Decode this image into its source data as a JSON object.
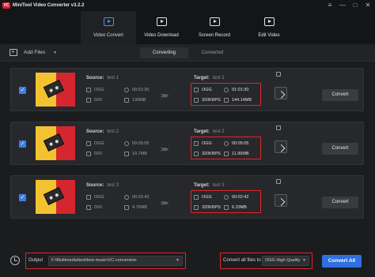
{
  "app": {
    "title": "MiniTool Video Converter v3.2.2",
    "logo_text": "VC"
  },
  "window_controls": [
    "≡",
    "—",
    "□",
    "✕"
  ],
  "nav": [
    {
      "label": "Video Convert",
      "icon": "video-convert-icon",
      "active": true
    },
    {
      "label": "Video Download",
      "icon": "video-download-icon",
      "active": false
    },
    {
      "label": "Screen Record",
      "icon": "screen-record-icon",
      "active": false
    },
    {
      "label": "Edit Video",
      "icon": "edit-video-icon",
      "active": false
    }
  ],
  "toolbar": {
    "add_files_label": "Add Files",
    "add_files_caret": "▼",
    "tabs": [
      "Converting",
      "Converted"
    ],
    "active_tab": "Converting"
  },
  "source_label": "Source:",
  "target_label": "Target:",
  "convert_label": "Convert",
  "arrows": ">>>",
  "files": [
    {
      "source_name": "test 1",
      "target_name": "test 1",
      "src_format": "OGG",
      "src_duration": "00:01:30",
      "src_res": "0X0",
      "src_size": "130MB",
      "tgt_format": "OGG",
      "tgt_duration": "01:01:30",
      "tgt_bitrate": "320KBPS",
      "tgt_size": "144.14MB"
    },
    {
      "source_name": "test 2",
      "target_name": "test 2",
      "src_format": "OGG",
      "src_duration": "00:05:05",
      "src_res": "0X0",
      "src_size": "10.7MB",
      "tgt_format": "OGG",
      "tgt_duration": "00:05:05",
      "tgt_bitrate": "320KBPS",
      "tgt_size": "11.96MB"
    },
    {
      "source_name": "test 3",
      "target_name": "test 3",
      "src_format": "OGG",
      "src_duration": "00:02:42",
      "src_res": "0X0",
      "src_size": "4.76MB",
      "tgt_format": "OGG",
      "tgt_duration": "00:02:42",
      "tgt_bitrate": "320KBPS",
      "tgt_size": "6.33MB"
    }
  ],
  "bottom": {
    "output_label": "Output",
    "output_path": "F:\\Multimedia\\test\\test-music\\VC-conversion",
    "caret": "▼",
    "convert_all_label": "Convert all files to",
    "format_value": "OGG High Quality",
    "convert_all_button": "Convert All"
  },
  "colors": {
    "accent": "#2f6fe0",
    "highlight_box": "#e0262b",
    "checkbox": "#3d7fe6"
  }
}
